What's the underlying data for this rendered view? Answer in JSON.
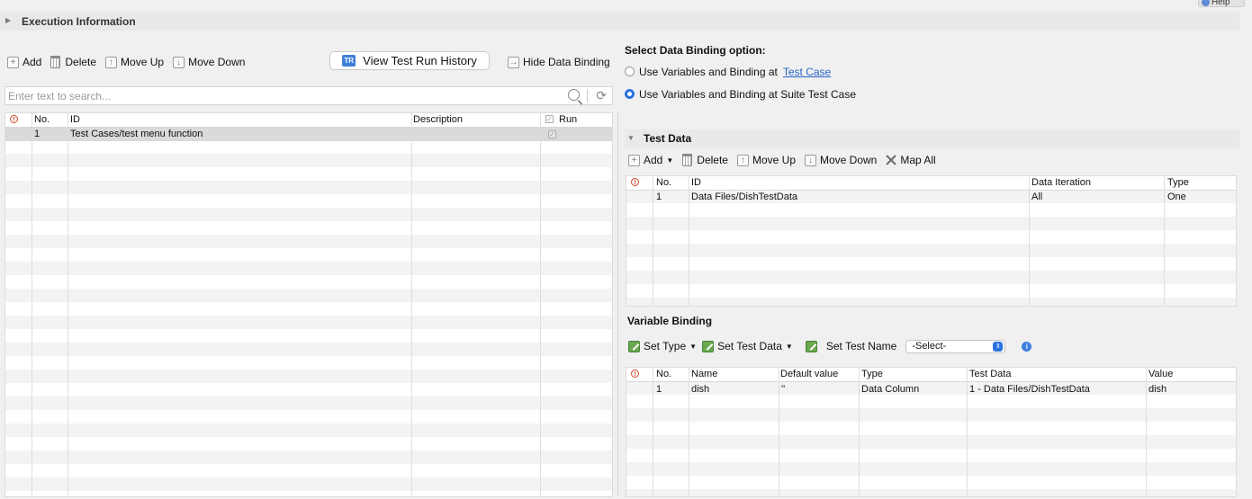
{
  "help_label": "Help",
  "execution_info": {
    "title": "Execution Information"
  },
  "left_toolbar": {
    "add": "Add",
    "delete": "Delete",
    "move_up": "Move Up",
    "move_down": "Move Down",
    "history": "View Test Run History",
    "hide_binding": "Hide Data Binding"
  },
  "search": {
    "placeholder": "Enter text to search..."
  },
  "test_table": {
    "columns": [
      "No.",
      "ID",
      "Description",
      "Run"
    ],
    "rows": [
      {
        "no": "1",
        "id": "Test Cases/test menu function",
        "description": "",
        "run": true
      }
    ]
  },
  "binding_option": {
    "title": "Select Data Binding option:",
    "opt1": "Use Variables and Binding at",
    "opt1_link": "Test Case",
    "opt2": "Use Variables and Binding at Suite Test Case",
    "selected": 2
  },
  "test_data": {
    "title": "Test Data",
    "toolbar": {
      "add": "Add",
      "delete": "Delete",
      "move_up": "Move Up",
      "move_down": "Move Down",
      "map_all": "Map All"
    },
    "columns": [
      "No.",
      "ID",
      "Data Iteration",
      "Type"
    ],
    "rows": [
      {
        "no": "1",
        "id": "Data Files/DishTestData",
        "iteration": "All",
        "type": "One"
      }
    ]
  },
  "variable_binding": {
    "title": "Variable Binding",
    "toolbar": {
      "set_type": "Set Type",
      "set_test_data": "Set Test Data",
      "set_test_name": "Set Test Name",
      "select_value": "-Select-"
    },
    "columns": [
      "No.",
      "Name",
      "Default value",
      "Type",
      "Test Data",
      "Value"
    ],
    "rows": [
      {
        "no": "1",
        "name": "dish",
        "default": "''",
        "type": "Data Column",
        "test_data": "1 - Data Files/DishTestData",
        "value": "dish"
      }
    ]
  },
  "colors": {
    "accent": "#2c73e0",
    "link": "#2563c9",
    "error": "#d04a2a",
    "selected_row": "#dadada"
  }
}
